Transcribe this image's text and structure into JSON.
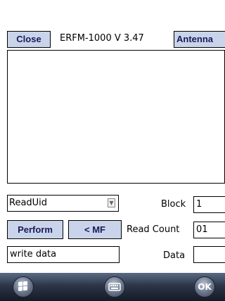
{
  "toolbar": {
    "close_label": "Close",
    "title": "ERFM-1000 V 3.47",
    "antenna_label": "Antenna"
  },
  "command": {
    "selected": "ReadUid"
  },
  "actions": {
    "perform_label": "Perform",
    "mf_label": "< MF"
  },
  "params": {
    "block_label": "Block",
    "block_value": "1",
    "read_count_label": "Read Count",
    "read_count_value": "01",
    "data_label": "Data",
    "data_value": ""
  },
  "write_data": {
    "value": "write data"
  },
  "taskbar": {
    "ok_label": "OK",
    "start_icon": "windows-logo-icon",
    "keyboard_icon": "keyboard-icon"
  },
  "colors": {
    "button_bg": "#c9d4ea",
    "button_text": "#1a1a5a",
    "taskbar_dark": "#141a26"
  }
}
